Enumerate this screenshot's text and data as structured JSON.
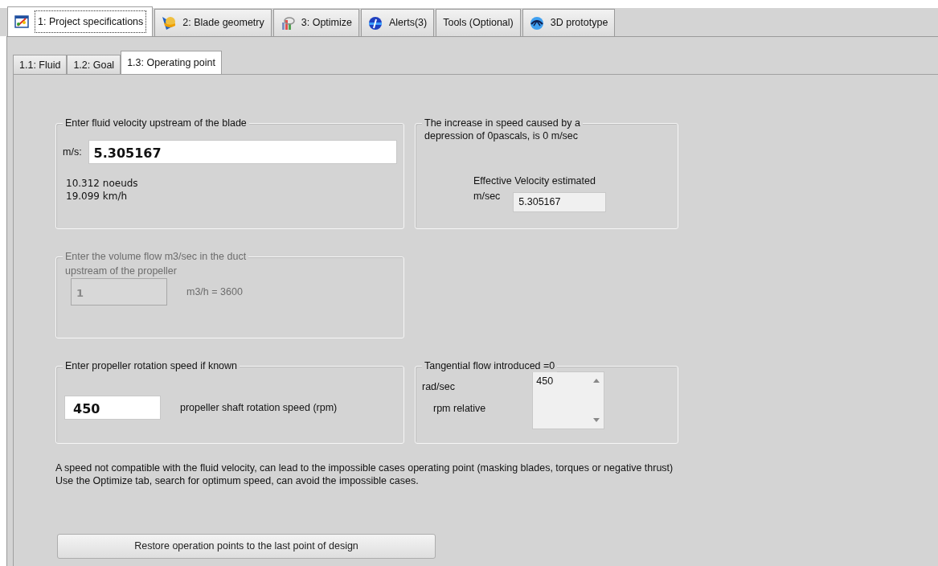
{
  "tabs": [
    {
      "label": "1: Project specifications",
      "icon": true,
      "selected": true
    },
    {
      "label": "2: Blade geometry",
      "icon": true,
      "selected": false
    },
    {
      "label": "3: Optimize",
      "icon": true,
      "selected": false
    },
    {
      "label": "Alerts(3)",
      "icon": true,
      "selected": false
    },
    {
      "label": "Tools (Optional)",
      "icon": false,
      "selected": false
    },
    {
      "label": "3D prototype",
      "icon": true,
      "selected": false
    }
  ],
  "subtabs": [
    {
      "label": "1.1: Fluid",
      "selected": false
    },
    {
      "label": "1.2: Goal",
      "selected": false
    },
    {
      "label": "1.3: Operating point",
      "selected": true
    }
  ],
  "velocity_group": {
    "title": "Enter fluid velocity  upstream of the blade",
    "unit_label": "m/s:",
    "value": "5.305167",
    "knots": "10.312 noeuds",
    "kmh": "19.099 km/h"
  },
  "increase_group": {
    "title": "The increase in speed caused by a",
    "title_line_2": "depression of 0pascals, is 0 m/sec",
    "effective_label": "Effective Velocity estimated",
    "effective_unit": "m/sec",
    "effective_value": "5.305167"
  },
  "volume_group": {
    "title": "Enter the volume flow m3/sec in the duct",
    "subtitle": "upstream of the propeller",
    "value": "1",
    "conversion": "m3/h = 3600",
    "disabled": true
  },
  "rotation_group": {
    "title": "Enter propeller rotation speed if known",
    "value": "450",
    "unit_label": "propeller shaft rotation speed (rpm)"
  },
  "tangential_group": {
    "title": "Tangential flow introduced =0",
    "unit_label": "rad/sec",
    "relative_label": "rpm relative",
    "value": "450"
  },
  "note": [
    "A speed not compatible with the fluid velocity, can lead to the impossible cases operating point (masking blades, torques or negative thrust)",
    "Use the Optimize tab, search for optimum speed, can avoid the impossible cases."
  ],
  "restore_button": "Restore operation points to the last point of design"
}
